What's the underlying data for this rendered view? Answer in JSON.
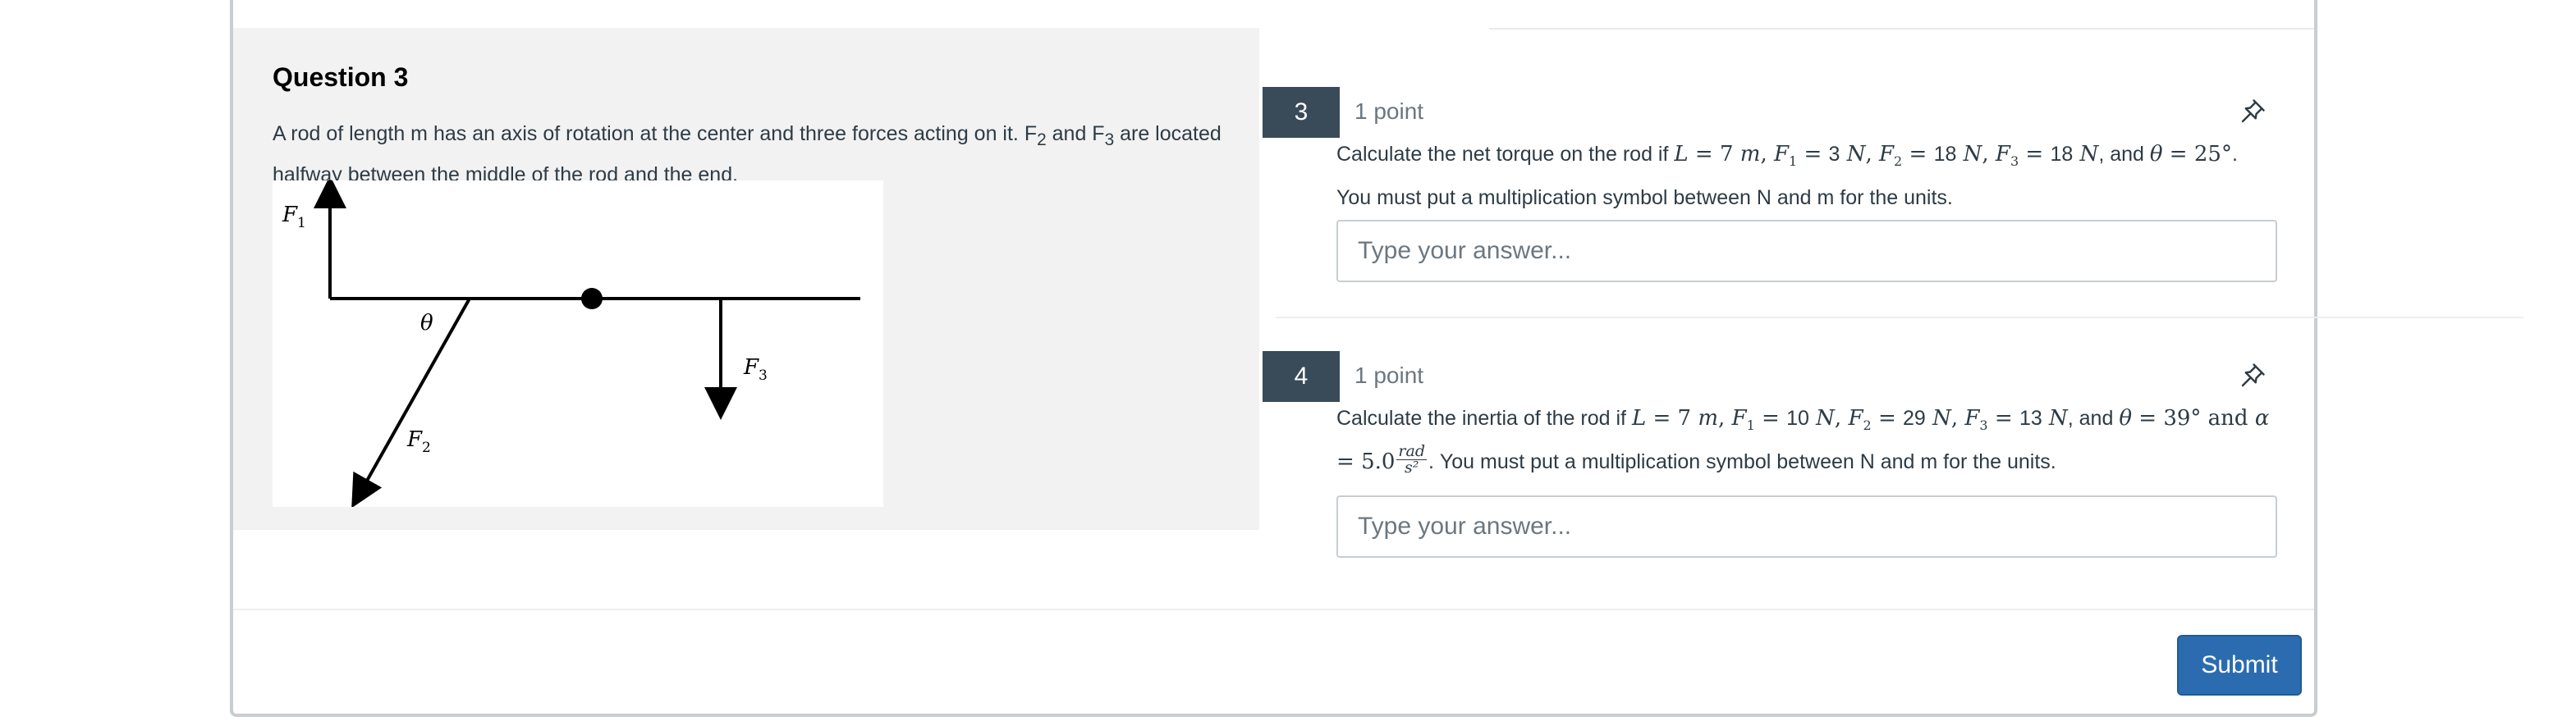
{
  "context": {
    "title": "Question 3",
    "text_part1": "A rod of length m has an axis of rotation at the center and three forces acting on it.  F",
    "f2_sub": "2",
    "text_part2": " and F",
    "f3_sub": "3",
    "text_part3": " are located halfway between the middle of the rod and the end.",
    "diagram_labels": {
      "f1": "F",
      "f1_sub": "1",
      "f2": "F",
      "f2_sub": "2",
      "f3": "F",
      "f3_sub": "3",
      "theta": "θ"
    }
  },
  "questions": [
    {
      "number": "3",
      "points": "1 point",
      "icon": "pin-icon",
      "text": {
        "t1": "Calculate the net torque on the rod if ",
        "L": "L",
        "eq": " = ",
        "L_val": "7",
        "L_unit": " m",
        "F1": "F",
        "F1_sub": "1",
        "F1_val": "3",
        "F1_unit": " N",
        "F2": "F",
        "F2_sub": "2",
        "F2_val": "18",
        "F2_unit": " N",
        "F3": "F",
        "F3_sub": "3",
        "F3_val": "18",
        "F3_unit": " N",
        "and": ", and ",
        "theta": "θ",
        "theta_val": "25°",
        "end": ".",
        "line2": "You must put a multiplication symbol between N and m for the units."
      },
      "placeholder": "Type your answer..."
    },
    {
      "number": "4",
      "points": "1 point",
      "icon": "pin-icon",
      "text": {
        "t1": "Calculate the inertia of the rod if ",
        "L": "L",
        "eq": " = ",
        "L_val": "7",
        "L_unit": " m",
        "F1": "F",
        "F1_sub": "1",
        "F1_val": "10",
        "F1_unit": " N",
        "F2": "F",
        "F2_sub": "2",
        "F2_val": "29",
        "F2_unit": " N",
        "F3": "F",
        "F3_sub": "3",
        "F3_val": "13",
        "F3_unit": " N",
        "and": ", and ",
        "theta": "θ",
        "theta_val": "39°",
        "and2": " and ",
        "alpha": "α",
        "alpha_val": "5.0",
        "frac_num": "rad",
        "frac_den": "s²",
        "end": ".  You must put a multiplication symbol between N and m for the units."
      },
      "placeholder": "Type your answer..."
    }
  ],
  "submit_label": "Submit",
  "colors": {
    "accent": "#2b6cb0",
    "number_badge": "#394b58",
    "context_bg": "#f2f2f2"
  }
}
